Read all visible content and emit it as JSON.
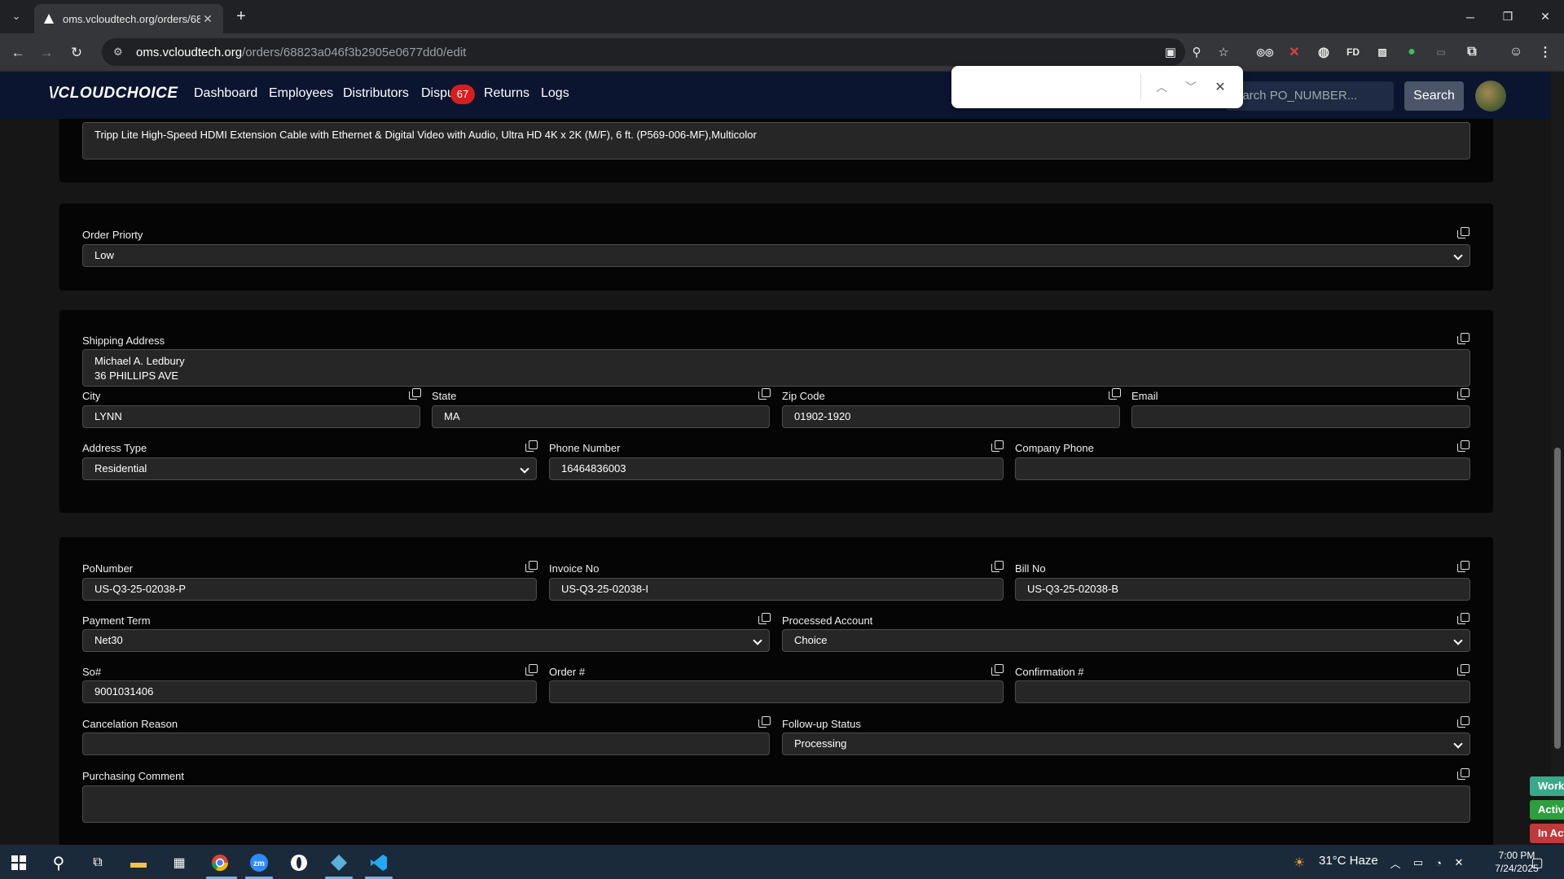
{
  "browser": {
    "tab_title": "oms.vcloudtech.org/orders/688",
    "url_host": "oms.vcloudtech.org",
    "url_path": "/orders/68823a046f3b2905e0677dd0/edit"
  },
  "nav": {
    "logo": "\\/CLOUDCHOICE",
    "links": [
      "Dashboard",
      "Employees",
      "Distributors",
      "Dispu",
      "Returns",
      "Logs"
    ],
    "dispute_badge": "67",
    "search_placeholder": "earch PO_NUMBER...",
    "search_button": "Search"
  },
  "product": {
    "description": "Tripp Lite High-Speed HDMI Extension Cable with Ethernet & Digital Video with Audio, Ultra HD 4K x 2K (M/F), 6 ft. (P569-006-MF),Multicolor"
  },
  "priority": {
    "label": "Order Priorty",
    "value": "Low"
  },
  "shipping": {
    "label": "Shipping Address",
    "line1": "Michael A. Ledbury",
    "line2": "36 PHILLIPS AVE",
    "city_label": "City",
    "city": "LYNN",
    "state_label": "State",
    "state": "MA",
    "zip_label": "Zip Code",
    "zip": "01902-1920",
    "email_label": "Email",
    "email": "",
    "address_type_label": "Address Type",
    "address_type": "Residential",
    "phone_label": "Phone Number",
    "phone": "16464836003",
    "company_phone_label": "Company Phone",
    "company_phone": ""
  },
  "order": {
    "po_label": "PoNumber",
    "po": "US-Q3-25-02038-P",
    "invoice_label": "Invoice No",
    "invoice": "US-Q3-25-02038-I",
    "bill_label": "Bill No",
    "bill": "US-Q3-25-02038-B",
    "payment_term_label": "Payment Term",
    "payment_term": "Net30",
    "processed_account_label": "Processed Account",
    "processed_account": "Choice",
    "so_label": "So#",
    "so": "9001031406",
    "order_no_label": "Order #",
    "order_no": "",
    "confirmation_label": "Confirmation #",
    "confirmation": "",
    "cancel_reason_label": "Cancelation Reason",
    "cancel_reason": "",
    "followup_label": "Follow-up Status",
    "followup": "Processing",
    "purchasing_comment_label": "Purchasing Comment",
    "purchasing_comment": ""
  },
  "side_tabs": [
    {
      "label": "Work",
      "color": "#3aa88a"
    },
    {
      "label": "Active",
      "color": "#2e9e3e"
    },
    {
      "label": "In Act",
      "color": "#c0393b"
    }
  ],
  "taskbar": {
    "weather": "31°C  Haze",
    "time": "7:00 PM",
    "date": "7/24/2025"
  }
}
